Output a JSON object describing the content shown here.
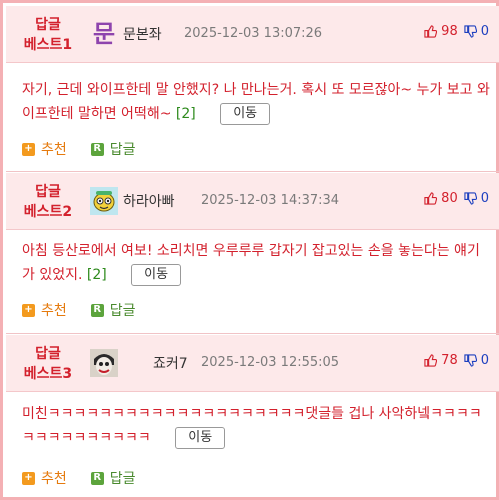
{
  "comments": [
    {
      "badge_line1": "답글",
      "badge_line2": "베스트1",
      "avatar": "text-logo-icon",
      "avatar_text": "문",
      "nickname": "문본좌",
      "datetime": "2025-12-03 13:07:26",
      "likes": "98",
      "dislikes": "0",
      "text": "자기, 근데 와이프한테 말 안했지? 나 만나는거. 혹시 또 모르잖아~ 누가 보고 와이프한테 말하면 어떡해~",
      "reply_count": "[2]",
      "move_label": "이동",
      "recommend_label": "추천",
      "reply_label": "답글"
    },
    {
      "badge_line1": "답글",
      "badge_line2": "베스트2",
      "avatar": "cartoon-face-icon",
      "nickname": "하라아빠",
      "datetime": "2025-12-03 14:37:34",
      "likes": "80",
      "dislikes": "0",
      "text": "아침 등산로에서 여보! 소리치면 우루루루 갑자기 잡고있는 손을 놓는다는 얘기가 있었지.",
      "reply_count": "[2]",
      "move_label": "이동",
      "recommend_label": "추천",
      "reply_label": "답글"
    },
    {
      "badge_line1": "답글",
      "badge_line2": "베스트3",
      "avatar": "joker-face-icon",
      "nickname": "죠커7",
      "datetime": "2025-12-03 12:55:05",
      "likes": "78",
      "dislikes": "0",
      "text": "미친ㅋㅋㅋㅋㅋㅋㅋㅋㅋㅋㅋㅋㅋㅋㅋㅋㅋㅋㅋㅋ댓글들 겁나 사악하넼ㅋㅋㅋㅋㅋㅋㅋㅋㅋㅋㅋㅋㅋㅋ",
      "move_label": "이동",
      "recommend_label": "추천",
      "reply_label": "답글"
    }
  ],
  "colors": {
    "accent_red": "#d3212d",
    "header_bg": "#fde9ea",
    "border": "#f4b0b4",
    "dislike_blue": "#1d3fbf",
    "reply_count_green": "#2d8a1c",
    "recommend_orange": "#e57a0e",
    "reply_green": "#4a8a2e"
  }
}
